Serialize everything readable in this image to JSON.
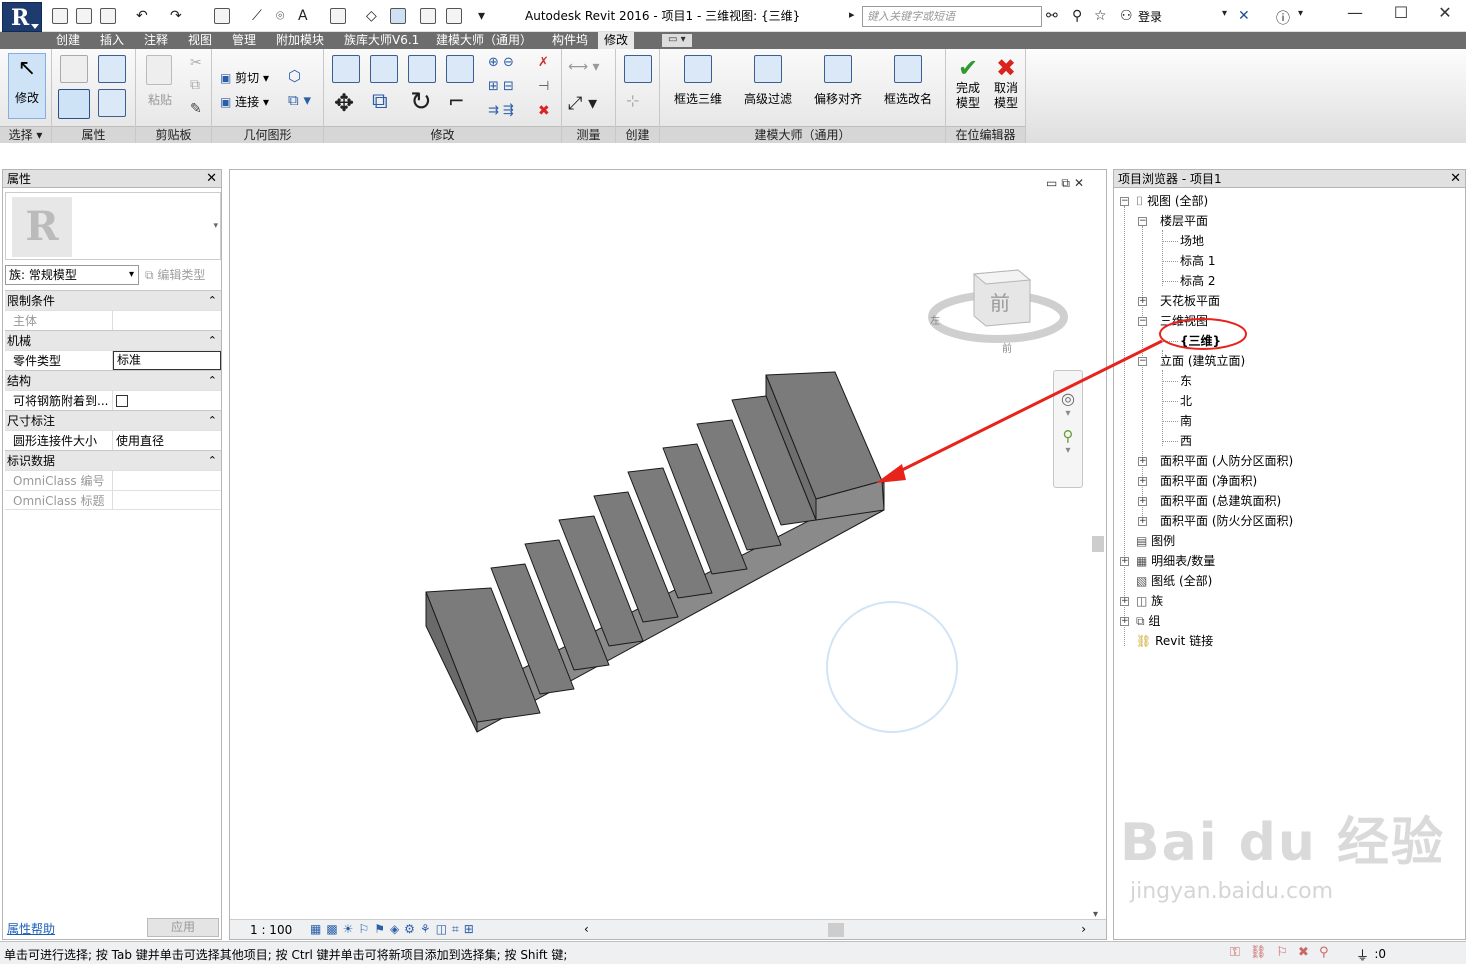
{
  "app": {
    "title": "Autodesk Revit 2016 -     项目1 - 三维视图: {三维}",
    "search_placeholder": "键入关键字或短语",
    "login_label": "登录"
  },
  "tabs": [
    "创建",
    "插入",
    "注释",
    "视图",
    "管理",
    "附加模块",
    "族库大师V6.1",
    "建模大师（通用）",
    "构件坞",
    "修改"
  ],
  "ribbon": {
    "modify_label": "修改",
    "panels": [
      "选择 ▾",
      "属性",
      "剪贴板",
      "几何图形",
      "修改",
      "测量",
      "创建",
      "建模大师（通用）",
      "在位编辑器"
    ],
    "paste_label": "粘贴",
    "cut_label": "剪切",
    "join_label": "连接",
    "jianmo_tools": [
      "框选三维",
      "高级过滤",
      "偏移对齐",
      "框选改名"
    ],
    "finish_label": "完成\n模型",
    "cancel_label": "取消\n模型"
  },
  "properties": {
    "title": "属性",
    "family_select": "族: 常规模型",
    "edit_type": "编辑类型",
    "groups": [
      {
        "name": "限制条件",
        "rows": [
          {
            "k": "主体",
            "v": "",
            "disabled": true
          }
        ]
      },
      {
        "name": "机械",
        "rows": [
          {
            "k": "零件类型",
            "v": "标准"
          }
        ]
      },
      {
        "name": "结构",
        "rows": [
          {
            "k": "可将钢筋附着到...",
            "v": ""
          }
        ]
      },
      {
        "name": "尺寸标注",
        "rows": [
          {
            "k": "圆形连接件大小",
            "v": "使用直径"
          }
        ]
      },
      {
        "name": "标识数据",
        "rows": [
          {
            "k": "OmniClass 编号",
            "v": "",
            "disabled": true
          },
          {
            "k": "OmniClass 标题",
            "v": "",
            "disabled": true
          }
        ]
      }
    ],
    "help_link": "属性帮助",
    "apply_button": "应用"
  },
  "view": {
    "scale": "1 : 100",
    "viewcube_face": "前",
    "compass_left": "左",
    "compass_front": "前"
  },
  "browser": {
    "title": "项目浏览器 - 项目1",
    "nodes": [
      {
        "label": "视图 (全部)"
      },
      {
        "label": "楼层平面"
      },
      {
        "label": "场地"
      },
      {
        "label": "标高 1"
      },
      {
        "label": "标高 2"
      },
      {
        "label": "天花板平面"
      },
      {
        "label": "三维视图"
      },
      {
        "label": "{三维}"
      },
      {
        "label": "立面 (建筑立面)"
      },
      {
        "label": "东"
      },
      {
        "label": "北"
      },
      {
        "label": "南"
      },
      {
        "label": "西"
      },
      {
        "label": "面积平面 (人防分区面积)"
      },
      {
        "label": "面积平面 (净面积)"
      },
      {
        "label": "面积平面 (总建筑面积)"
      },
      {
        "label": "面积平面 (防火分区面积)"
      },
      {
        "label": "图例"
      },
      {
        "label": "明细表/数量"
      },
      {
        "label": "图纸 (全部)"
      },
      {
        "label": "族"
      },
      {
        "label": "组"
      },
      {
        "label": "Revit 链接"
      }
    ]
  },
  "status": {
    "text": "单击可进行选择; 按 Tab 键并单击可选择其他项目; 按 Ctrl 键并单击可将新项目添加到选择集; 按 Shift 键;",
    "count": ":0"
  },
  "watermark": {
    "brand": "Bai du 经验",
    "url": "jingyan.baidu.com"
  },
  "colors": {
    "accent": "#1d3b6e",
    "annotation": "#e8231b",
    "stair": "#7d7d7d"
  }
}
